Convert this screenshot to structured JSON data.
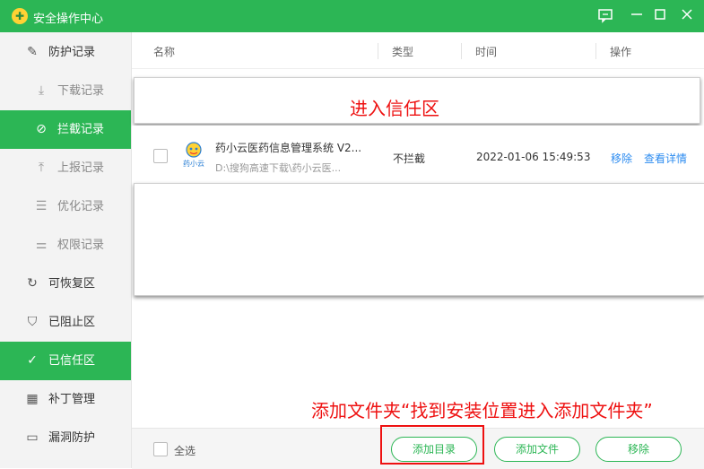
{
  "window": {
    "title": "安全操作中心",
    "logo_icon": "app-logo-icon",
    "controls": [
      "feedback-icon",
      "minimize-icon",
      "maximize-icon",
      "close-icon"
    ]
  },
  "sidebar": {
    "items": [
      {
        "label": "防护记录",
        "icon": "edit-icon"
      },
      {
        "label": "下载记录",
        "icon": "download-icon"
      },
      {
        "label": "拦截记录",
        "icon": "block-icon"
      },
      {
        "label": "上报记录",
        "icon": "upload-icon"
      },
      {
        "label": "优化记录",
        "icon": "document-icon"
      },
      {
        "label": "权限记录",
        "icon": "permission-icon"
      },
      {
        "label": "可恢复区",
        "icon": "restore-icon"
      },
      {
        "label": "已阻止区",
        "icon": "shield-alert-icon"
      },
      {
        "label": "已信任区",
        "icon": "shield-check-icon"
      },
      {
        "label": "补丁管理",
        "icon": "grid-icon"
      },
      {
        "label": "漏洞防护",
        "icon": "monitor-icon"
      }
    ]
  },
  "table": {
    "columns": [
      "名称",
      "类型",
      "时间",
      "操作"
    ],
    "rows": [
      {
        "app_icon": "yao-xiao-yun-icon",
        "app_icon_text": "药小云",
        "name": "药小云医药信息管理系统 V2...",
        "path": "D:\\搜狗高速下载\\药小云医...",
        "type": "不拦截",
        "time": "2022-01-06 15:49:53",
        "actions": [
          "移除",
          "查看详情"
        ]
      }
    ]
  },
  "popup": {
    "text": "进入信任区"
  },
  "footer": {
    "select_all": "全选",
    "buttons": [
      "添加目录",
      "添加文件",
      "移除"
    ]
  },
  "annotation": {
    "text": "添加文件夹“找到安装位置进入添加文件夹”"
  },
  "colors": {
    "accent": "#2cb655",
    "annotation": "#e11111",
    "link": "#2d8cf0"
  }
}
